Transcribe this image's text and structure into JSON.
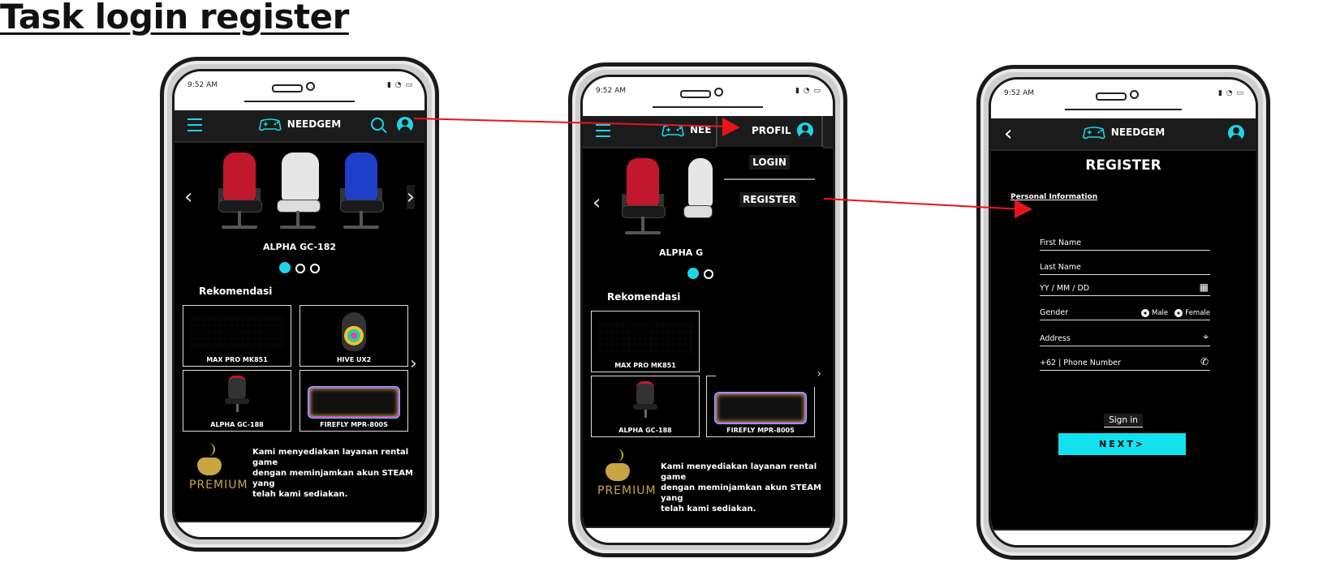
{
  "page_title": "Task login register",
  "status_time": "9:52 AM",
  "brand_name": "NEEDGEM",
  "colors": {
    "accent": "#1ed4e8",
    "button": "#11e2ee",
    "arrow": "#e8141c",
    "gold": "#c9a443",
    "appbar": "#1b1b1b"
  },
  "home": {
    "banner_caption": "ALPHA GC-182",
    "recommend_title": "Rekomendasi",
    "products": [
      "MAX PRO MK851",
      "HIVE UX2",
      "ALPHA GC-188",
      "FIREFLY MPR-800S"
    ],
    "premium_word": "PREMIUM",
    "premium_desc_lines": [
      "Kami menyediakan layanan rental game",
      "dengan meminjamkan akun STEAM yang",
      "telah kami sediakan."
    ]
  },
  "menu_screen": {
    "profil_label": "PROFIL",
    "login_label": "LOGIN",
    "register_label": "REGISTER",
    "banner_caption_partial": "ALPHA G",
    "brand_partial": "NEE"
  },
  "register": {
    "title": "REGISTER",
    "section": "Personal Information",
    "first_name": "First Name",
    "last_name": "Last Name",
    "dob": "YY / MM / DD",
    "gender_label": "Gender",
    "gender_male": "Male",
    "gender_female": "Female",
    "address": "Address",
    "phone": "+62  |  Phone Number",
    "sign_in": "Sign in",
    "next": "NEXT>"
  },
  "icons": [
    "menu-icon",
    "controller-logo-icon",
    "search-icon",
    "user-icon",
    "back-icon",
    "calendar-icon",
    "location-pin-icon",
    "phone-icon",
    "chevron-left-icon",
    "chevron-right-icon"
  ]
}
